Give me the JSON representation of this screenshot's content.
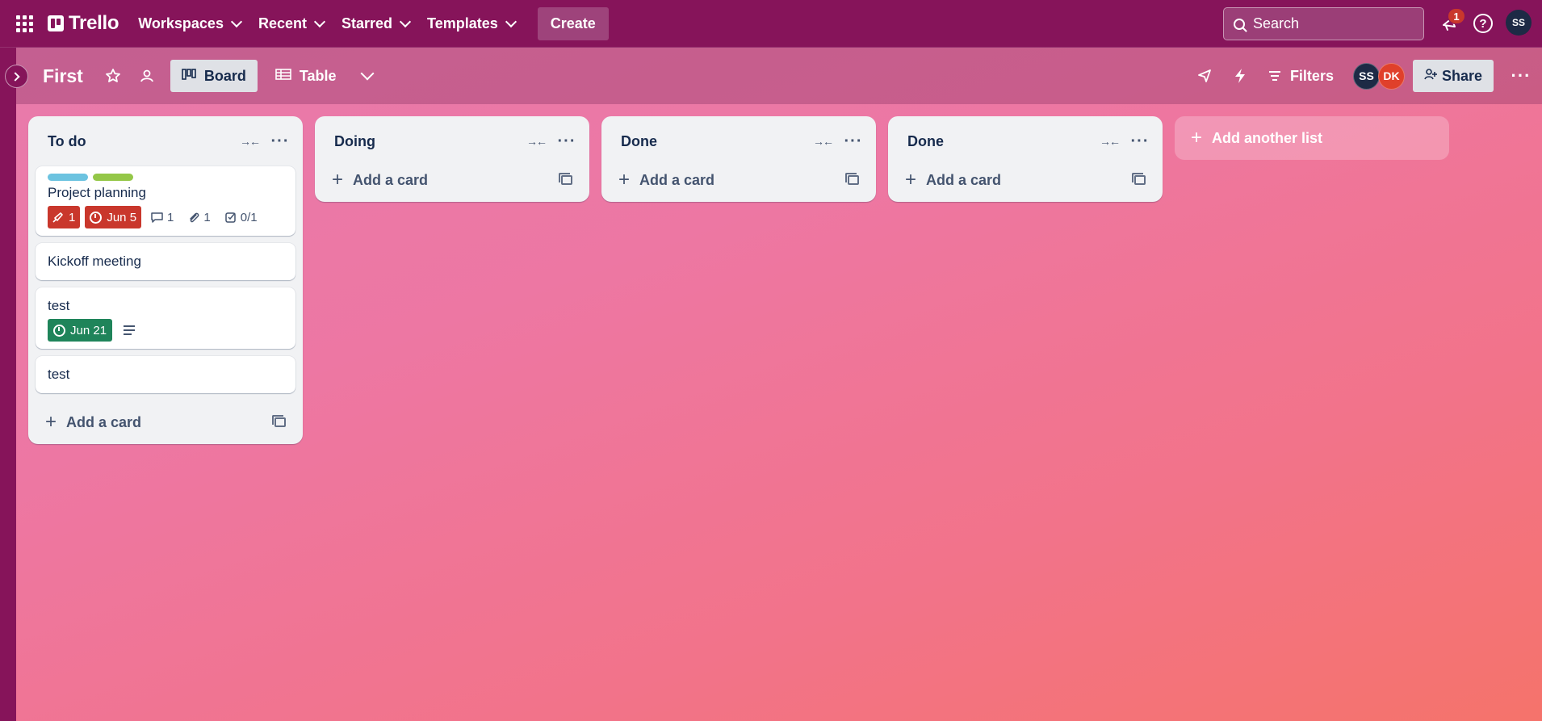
{
  "topnav": {
    "logo_text": "Trello",
    "menu": [
      {
        "label": "Workspaces"
      },
      {
        "label": "Recent"
      },
      {
        "label": "Starred"
      },
      {
        "label": "Templates"
      }
    ],
    "create_label": "Create",
    "search_placeholder": "Search",
    "notification_count": "1",
    "help_label": "?",
    "avatar_initials": "SS"
  },
  "board": {
    "title": "First",
    "views": [
      {
        "label": "Board",
        "active": true
      },
      {
        "label": "Table",
        "active": false
      }
    ],
    "filters_label": "Filters",
    "members": [
      {
        "initials": "SS",
        "color": "#1d2a45"
      },
      {
        "initials": "DK",
        "color": "#e0402b"
      }
    ],
    "share_label": "Share"
  },
  "lists": [
    {
      "title": "To do",
      "cards": [
        {
          "title": "Project planning",
          "labels": [
            "#6cc3e0",
            "#94c748"
          ],
          "badges": {
            "votes": "1",
            "due": "Jun 5",
            "comments": "1",
            "attachments": "1",
            "checklist": "0/1"
          }
        },
        {
          "title": "Kickoff meeting"
        },
        {
          "title": "test",
          "badges": {
            "due": "Jun 21",
            "has_description": true
          }
        },
        {
          "title": "test"
        }
      ],
      "add_card_label": "Add a card"
    },
    {
      "title": "Doing",
      "cards": [],
      "add_card_label": "Add a card"
    },
    {
      "title": "Done",
      "cards": [],
      "add_card_label": "Add a card"
    },
    {
      "title": "Done",
      "cards": [],
      "add_card_label": "Add a card"
    }
  ],
  "add_list_label": "Add another list",
  "colors": {
    "topbar": "#86145a",
    "due_overdue": "#c9372c",
    "due_upcoming": "#1f845a",
    "label_blue": "#6cc3e0",
    "label_green": "#94c748"
  }
}
